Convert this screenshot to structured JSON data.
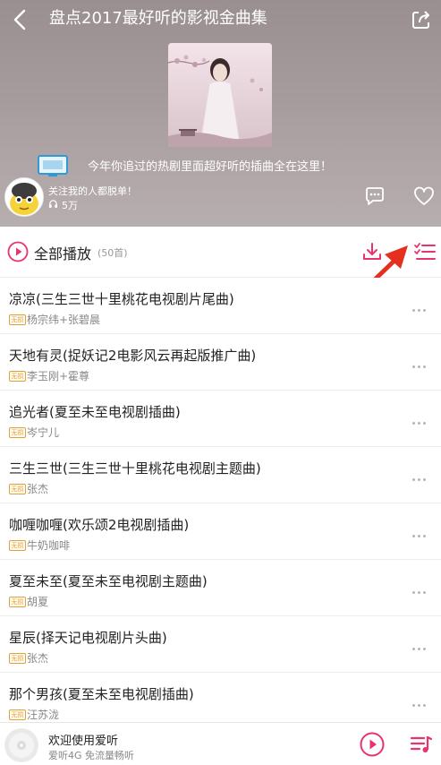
{
  "header": {
    "title": "盘点2017最好听的影视金曲集",
    "description": "今年你追过的热剧里面超好听的插曲全在这里！",
    "creator_name": "关注我的人都脱单！",
    "listen_count": "5万"
  },
  "toolbar": {
    "play_all_label": "全部播放",
    "song_count": "(50首)"
  },
  "songs": [
    {
      "title": "凉凉(三生三世十里桃花电视剧片尾曲)",
      "artist": "杨宗纬+张碧晨",
      "badge": "无损"
    },
    {
      "title": "天地有灵(捉妖记2电影风云再起版推广曲)",
      "artist": "李玉刚+霍尊",
      "badge": "无损"
    },
    {
      "title": "追光者(夏至未至电视剧插曲)",
      "artist": "岑宁儿",
      "badge": "无损"
    },
    {
      "title": "三生三世(三生三世十里桃花电视剧主题曲)",
      "artist": "张杰",
      "badge": "无损"
    },
    {
      "title": "咖喱咖喱(欢乐颂2电视剧插曲)",
      "artist": "牛奶咖啡",
      "badge": "无损"
    },
    {
      "title": "夏至未至(夏至未至电视剧主题曲)",
      "artist": "胡夏",
      "badge": "无损"
    },
    {
      "title": "星辰(择天记电视剧片头曲)",
      "artist": "张杰",
      "badge": "无损"
    },
    {
      "title": "那个男孩(夏至未至电视剧插曲)",
      "artist": "汪苏泷",
      "badge": "无损"
    }
  ],
  "player": {
    "title": "欢迎使用爱听",
    "subtitle": "爱听4G 免流量畅听"
  },
  "colors": {
    "accent": "#e8336d",
    "annotation_arrow": "#e53020",
    "badge": "#e0a23a"
  },
  "icons": [
    "back-icon",
    "share-icon",
    "tv-icon",
    "headphone-icon",
    "comment-icon",
    "like-icon",
    "play-all-icon",
    "download-icon",
    "multi-select-icon",
    "more-icon",
    "disc-icon",
    "play-icon",
    "playlist-icon"
  ]
}
